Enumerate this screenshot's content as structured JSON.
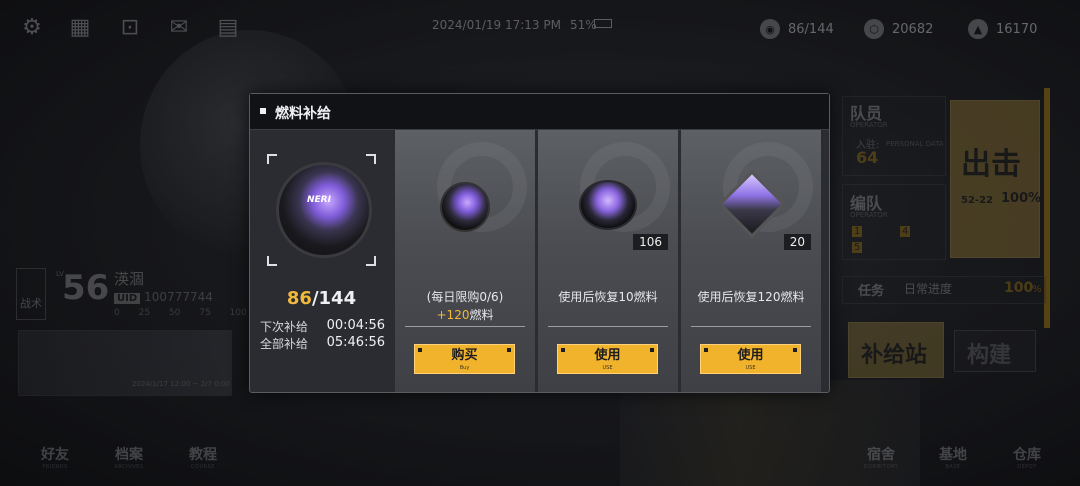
{
  "status": {
    "datetime": "2024/01/19 17:13 PM",
    "battery": "51%"
  },
  "resources": [
    {
      "name": "stamina-icon",
      "value": "86/144"
    },
    {
      "name": "coin-icon",
      "value": "20682"
    },
    {
      "name": "crystal-icon",
      "value": "16170"
    }
  ],
  "player": {
    "level_label": "LV",
    "level": "56",
    "tactics_label": "战术",
    "tactics_sub": "TACTICS",
    "name": "渶涸",
    "uid_label": "UID",
    "uid": "100777744",
    "ticks": "0 25 50 75 100",
    "banner_date": "2024/1/17 12:00 ~ 2/7 0:00"
  },
  "bottom_nav": [
    {
      "label": "好友",
      "sub": "FRIENDS"
    },
    {
      "label": "档案",
      "sub": "ARCHIVES"
    },
    {
      "label": "教程",
      "sub": "COURSE"
    },
    {
      "label": "宿舍",
      "sub": "DORMITORY"
    },
    {
      "label": "基地",
      "sub": "BASE"
    },
    {
      "label": "仓库",
      "sub": "DEPOT"
    }
  ],
  "right_panel": {
    "operator_title": "队员",
    "operator_sub": "OPERATOR",
    "enlisted_label": "入驻:",
    "enlisted_count": "64",
    "personal_data": "PERSONAL DATA",
    "formation_title": "编队",
    "formation_sub": "OPERATOR",
    "sortie_title": "出击",
    "sortie_sub": "PREPARE AND MISSION",
    "sortie_stage": "52-22",
    "sortie_pct": "100%",
    "mission_title": "任务",
    "mission_sub": "MISSION",
    "daily_label": "日常进度",
    "daily_sub": "TASK PROGRESS",
    "daily_pct": "100",
    "daily_pct_unit": "%",
    "supply_title": "补给站",
    "supply_sub": "STORE",
    "build_title": "构建",
    "build_sub": "REALIZE TECH",
    "slots": [
      "1",
      "4",
      "5"
    ]
  },
  "modal": {
    "title": "燃料补给",
    "current_fuel": "86",
    "max_fuel": "/144",
    "next_label": "下次补给",
    "next_time": "00:04:56",
    "full_label": "全部补给",
    "full_time": "05:46:56",
    "item_brand": "NERI",
    "cards": [
      {
        "desc": "(每日限购0/6)",
        "bonus_plus": "+120",
        "bonus_unit": "燃料",
        "qty": "",
        "btn": "购买",
        "btn_sub": "Buy"
      },
      {
        "desc": "使用后恢复10燃料",
        "bonus_plus": "",
        "bonus_unit": "",
        "qty": "106",
        "btn": "使用",
        "btn_sub": "USE"
      },
      {
        "desc": "使用后恢复120燃料",
        "bonus_plus": "",
        "bonus_unit": "",
        "qty": "20",
        "btn": "使用",
        "btn_sub": "USE"
      }
    ]
  },
  "colors": {
    "accent": "#f1b32c",
    "fuel_count": "#f1b83a",
    "modal_bg": "#2a2c31"
  }
}
